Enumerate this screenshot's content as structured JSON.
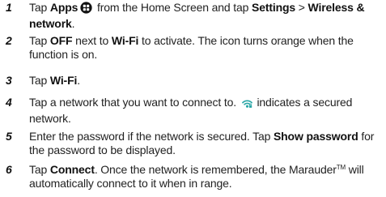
{
  "steps": [
    {
      "number": "1",
      "t1": "Tap ",
      "b1": "Apps",
      "icon": "apps-grid-icon",
      "t2": " from the Home Screen and tap ",
      "b2": "Settings",
      "t3": " > ",
      "b3": "Wireless & network",
      "t4": "."
    },
    {
      "number": "2",
      "t1": "Tap ",
      "b1": "OFF",
      "t2": " next to ",
      "b2": "Wi-Fi",
      "t3": " to activate. The icon turns orange when the function is on."
    },
    {
      "number": "3",
      "t1": "Tap ",
      "b1": "Wi-Fi",
      "t2": "."
    },
    {
      "number": "4",
      "t1": "Tap a network that you want to connect to. ",
      "icon": "secured-wifi-icon",
      "t2": " indicates a secured network."
    },
    {
      "number": "5",
      "t1": "Enter the password if the network is secured. Tap ",
      "b1": "Show password",
      "t2": " for the password to be displayed."
    },
    {
      "number": "6",
      "t1": "Tap ",
      "b1": "Connect",
      "t2": ". Once the network is remembered, the Marauder",
      "tm": "TM",
      "t3": " will automatically connect to it when in range."
    }
  ],
  "colors": {
    "text": "#222222",
    "wifi_icon": "#2aa6a6"
  }
}
